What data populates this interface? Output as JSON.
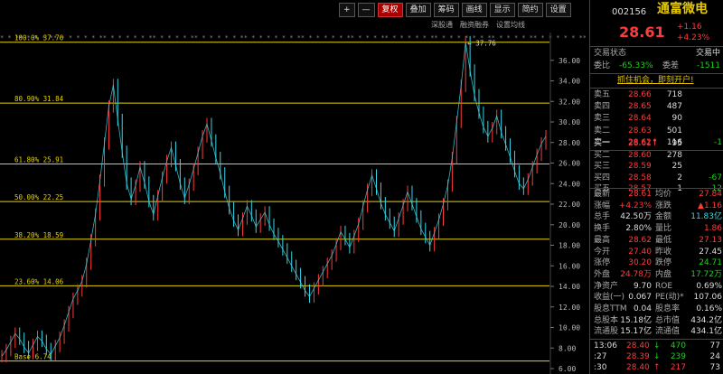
{
  "toolbar": {
    "buttons": [
      "+",
      "—",
      "复权",
      "叠加",
      "筹码",
      "画线",
      "显示",
      "简约",
      "设置"
    ],
    "active_index": 2
  },
  "subtabs": [
    "深股通",
    "融资融券",
    "设置均线"
  ],
  "chart_data": {
    "type": "line",
    "ylim": [
      6.0,
      38.0
    ],
    "y_ticks": [
      36.0,
      34.0,
      32.0,
      30.0,
      28.0,
      26.0,
      24.0,
      22.0,
      20.0,
      18.0,
      16.0,
      14.0,
      12.0,
      10.0,
      8.0,
      6.0
    ],
    "y_tick_labels": [
      "36.00",
      "34.00",
      "32.00",
      "30.00",
      "28.00",
      "26.00",
      "24.00",
      "22.00",
      "20.00",
      "18.00",
      "16.00",
      "14.00",
      "12.00",
      "10.00",
      "8.00",
      "6.00"
    ],
    "fib_levels": [
      {
        "label": "100.0% 37.76",
        "value": 37.76
      },
      {
        "label": "80.90% 31.84",
        "value": 31.84
      },
      {
        "label": "61.80% 25.91",
        "value": 25.91
      },
      {
        "label": "50.00% 22.25",
        "value": 22.25
      },
      {
        "label": "38.20% 18.59",
        "value": 18.59
      },
      {
        "label": "23.60% 14.06",
        "value": 14.06
      },
      {
        "label": "Base 6.74",
        "value": 6.74
      }
    ],
    "peak_label": "← 37.76",
    "series": [
      {
        "values": [
          7.2,
          7.8,
          8.6,
          9.4,
          8.9,
          8.1,
          7.5,
          8.3,
          9.1,
          8.7,
          7.9,
          7.4,
          8.2,
          9.0,
          10.2,
          11.5,
          12.8,
          13.6,
          14.5,
          16.2,
          18.5,
          21.0,
          24.3,
          27.9,
          31.5,
          33.6,
          30.2,
          27.1,
          24.0,
          22.5,
          23.8,
          25.6,
          24.1,
          22.3,
          21.0,
          22.8,
          24.6,
          26.2,
          27.5,
          25.8,
          24.0,
          22.6,
          23.9,
          25.4,
          27.0,
          28.6,
          29.8,
          28.2,
          26.5,
          25.0,
          23.2,
          21.6,
          20.4,
          19.5,
          20.6,
          21.8,
          20.9,
          19.8,
          20.5,
          21.2,
          20.0,
          19.1,
          18.4,
          17.6,
          16.8,
          16.0,
          15.2,
          14.4,
          13.6,
          13.0,
          13.8,
          14.6,
          15.4,
          16.2,
          17.0,
          18.1,
          19.3,
          18.6,
          17.8,
          18.9,
          20.1,
          21.8,
          23.4,
          24.8,
          23.5,
          22.1,
          21.0,
          20.2,
          19.4,
          20.6,
          21.9,
          23.2,
          22.0,
          20.8,
          19.6,
          18.8,
          18.0,
          19.2,
          20.5,
          22.0,
          23.8,
          26.5,
          30.0,
          33.5,
          37.76,
          35.0,
          32.6,
          30.9,
          29.5,
          28.6,
          29.4,
          30.6,
          29.0,
          27.8,
          26.6,
          25.2,
          24.0,
          23.5,
          24.4,
          25.6,
          26.8,
          27.9,
          28.61
        ]
      }
    ]
  },
  "panel": {
    "code": "002156",
    "name": "通富微电",
    "price": "28.61",
    "change": "+1.16",
    "change_pct": "+4.23%",
    "status_label": "交易状态",
    "status_value": "交易中",
    "ratio_label": "委比",
    "ratio_value": "-65.33%",
    "diff_label": "委差",
    "diff_value": "-1511",
    "promo": "抓住机会，即刻开户!",
    "asks": [
      {
        "label": "卖五",
        "price": "28.66",
        "vol": "718"
      },
      {
        "label": "卖四",
        "price": "28.65",
        "vol": "487"
      },
      {
        "label": "卖三",
        "price": "28.64",
        "vol": "90"
      },
      {
        "label": "卖二",
        "price": "28.63",
        "vol": "501"
      },
      {
        "label": "卖一",
        "price": "28.62↑",
        "vol": "116",
        "chg": "-1"
      }
    ],
    "bids": [
      {
        "label": "买一",
        "price": "28.61↑",
        "vol": "95",
        "chg": ""
      },
      {
        "label": "买二",
        "price": "28.60",
        "vol": "278",
        "chg": ""
      },
      {
        "label": "买三",
        "price": "28.59",
        "vol": "25",
        "chg": ""
      },
      {
        "label": "买四",
        "price": "28.58",
        "vol": "2",
        "chg": "-67"
      },
      {
        "label": "买五",
        "price": "28.57",
        "vol": "1",
        "chg": "-12"
      }
    ],
    "stats": [
      {
        "l1": "最新",
        "v1": "28.61",
        "c1": "red",
        "l2": "均价",
        "v2": "27.84",
        "c2": "red"
      },
      {
        "l1": "涨幅",
        "v1": "+4.23%",
        "c1": "red",
        "l2": "涨跌",
        "v2": "▲1.16",
        "c2": "red"
      },
      {
        "l1": "总手",
        "v1": "42.50万",
        "c1": "wht",
        "l2": "金额",
        "v2": "11.83亿",
        "c2": "cyan"
      },
      {
        "l1": "换手",
        "v1": "2.80%",
        "c1": "wht",
        "l2": "量比",
        "v2": "1.86",
        "c2": "red"
      },
      {
        "l1": "最高",
        "v1": "28.62",
        "c1": "red",
        "l2": "最低",
        "v2": "27.13",
        "c2": "red"
      },
      {
        "l1": "今开",
        "v1": "27.40",
        "c1": "red",
        "l2": "昨收",
        "v2": "27.45",
        "c2": "wht"
      },
      {
        "l1": "涨停",
        "v1": "30.20",
        "c1": "red",
        "l2": "跌停",
        "v2": "24.71",
        "c2": "green"
      },
      {
        "l1": "外盘",
        "v1": "24.78万",
        "c1": "red",
        "l2": "内盘",
        "v2": "17.72万",
        "c2": "green"
      },
      {
        "l1": "净资产",
        "v1": "9.70",
        "c1": "wht",
        "l2": "ROE",
        "v2": "0.69%",
        "c2": "wht"
      },
      {
        "l1": "收益(一)",
        "v1": "0.067",
        "c1": "wht",
        "l2": "PE(动)*",
        "v2": "107.06",
        "c2": "wht"
      },
      {
        "l1": "股息TTM",
        "v1": "0.04",
        "c1": "wht",
        "l2": "股息率",
        "v2": "0.16%",
        "c2": "wht"
      },
      {
        "l1": "总股本",
        "v1": "15.18亿",
        "c1": "wht",
        "l2": "总市值",
        "v2": "434.2亿",
        "c2": "wht"
      },
      {
        "l1": "流通股",
        "v1": "15.17亿",
        "c1": "wht",
        "l2": "流通值",
        "v2": "434.1亿",
        "c2": "wht"
      }
    ],
    "ticks": [
      {
        "time": "13:06",
        "price": "28.40",
        "arrow": "↓",
        "vol": "470",
        "n": "77"
      },
      {
        "time": ":27",
        "price": "28.39",
        "arrow": "↓",
        "vol": "239",
        "n": "24"
      },
      {
        "time": ":30",
        "price": "28.40",
        "arrow": "↑",
        "vol": "217",
        "n": "73"
      }
    ],
    "colors": {
      "up": "#ff3b3b",
      "down": "#19d419",
      "fib": "#e6d200",
      "line": "#36d6e8"
    }
  }
}
